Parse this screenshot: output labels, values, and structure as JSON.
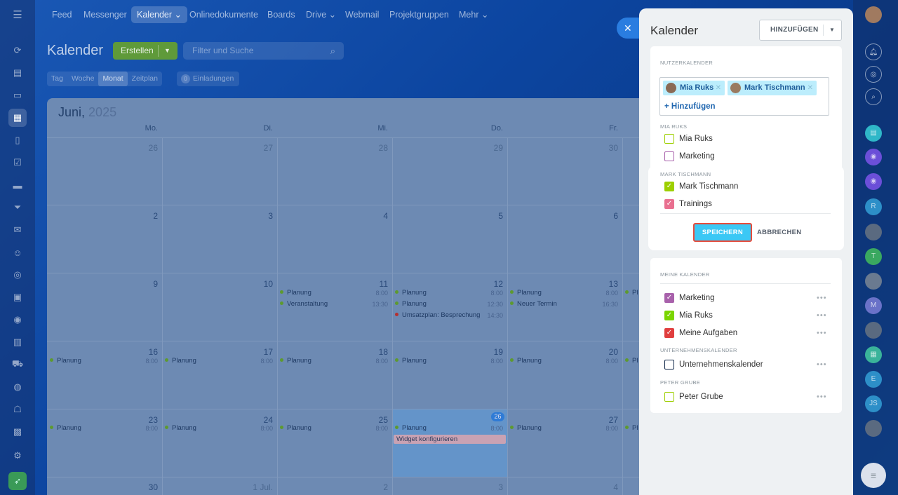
{
  "topnav": {
    "items": [
      {
        "label": "Feed"
      },
      {
        "label": "Messenger"
      },
      {
        "label": "Kalender ⌄"
      },
      {
        "label": "Onlinedokumente"
      },
      {
        "label": "Boards"
      },
      {
        "label": "Drive ⌄"
      },
      {
        "label": "Webmail"
      },
      {
        "label": "Projektgruppen"
      },
      {
        "label": "Mehr ⌄"
      }
    ]
  },
  "header": {
    "title": "Kalender",
    "create_label": "Erstellen",
    "search_placeholder": "Filter und Suche"
  },
  "view_tabs": {
    "items": [
      "Tag",
      "Woche",
      "Monat",
      "Zeitplan"
    ],
    "active": "Monat",
    "invitations_count": "0",
    "invitations_label": "Einladungen"
  },
  "calendar": {
    "month": "Juni,",
    "year": "2025",
    "weekdays": [
      "Mo.",
      "Di.",
      "Mi.",
      "Do.",
      "Fr."
    ],
    "weeks": [
      {
        "days": [
          "26",
          "27",
          "28",
          "29",
          "30"
        ]
      },
      {
        "days": [
          "2",
          "3",
          "4",
          "5",
          "6"
        ]
      },
      {
        "days": [
          "9",
          "10",
          "11",
          "12",
          "13"
        ]
      },
      {
        "days": [
          "16",
          "17",
          "18",
          "19",
          "20"
        ]
      },
      {
        "days": [
          "23",
          "24",
          "25",
          "26",
          "27"
        ]
      },
      {
        "days": [
          "30",
          "1 Jul.",
          "2",
          "3",
          "4"
        ]
      }
    ],
    "events": {
      "w3_wed_1": {
        "title": "Planung",
        "time": "8:00"
      },
      "w3_wed_2": {
        "title": "Veranstaltung",
        "time": "13:30"
      },
      "w3_thu_1": {
        "title": "Planung",
        "time": "8:00"
      },
      "w3_thu_2": {
        "title": "Planung",
        "time": "12:30"
      },
      "w3_thu_3": {
        "title": "Umsatzplan: Besprechung",
        "time": "14:30"
      },
      "w3_fri_1": {
        "title": "Planung",
        "time": "8:00"
      },
      "w3_fri_2": {
        "title": "Neuer Termin",
        "time": "16:30"
      },
      "w3_sat_1": {
        "title": "Pl"
      },
      "planung": "Planung",
      "time_800": "8:00",
      "pl_cut": "Pl",
      "widget": "Widget konfigurieren"
    }
  },
  "panel": {
    "title": "Kalender",
    "add_button": "HINZUFÜGEN",
    "user_calendars_label": "NUTZERKALENDER",
    "tags": [
      {
        "name": "Mia Ruks"
      },
      {
        "name": "Mark Tischmann"
      }
    ],
    "tag_add": "+ Hinzufügen",
    "mia_section": "MIA RUKS",
    "mia_items": [
      {
        "label": "Mia Ruks",
        "color": "#9dcf00",
        "checked": false
      },
      {
        "label": "Marketing",
        "color": "#a861ab",
        "checked": false
      }
    ],
    "mark_section": "MARK TISCHMANN",
    "mark_items": [
      {
        "label": "Mark Tischmann",
        "color": "#9dcf00",
        "checked": true
      },
      {
        "label": "Trainings",
        "color": "#e97090",
        "checked": true
      }
    ],
    "save_button": "SPEICHERN",
    "cancel_button": "ABBRECHEN",
    "my_calendars_label": "MEINE KALENDER",
    "my_items": [
      {
        "label": "Marketing",
        "color": "#a861ab",
        "checked": true
      },
      {
        "label": "Mia Ruks",
        "color": "#7bd500",
        "checked": true
      },
      {
        "label": "Meine Aufgaben",
        "color": "#e03e3e",
        "checked": true
      }
    ],
    "company_label": "UNTERNEHMENSKALENDER",
    "company_items": [
      {
        "label": "Unternehmenskalender",
        "color": "#11284a",
        "checked": false
      }
    ],
    "peter_label": "PETER GRUBE",
    "peter_items": [
      {
        "label": "Peter Grube",
        "color": "#9dcf00",
        "checked": false
      }
    ],
    "more_dots": "•••"
  },
  "rightbar": {
    "initials": [
      "R",
      "T",
      "M",
      "E",
      "JS"
    ]
  }
}
